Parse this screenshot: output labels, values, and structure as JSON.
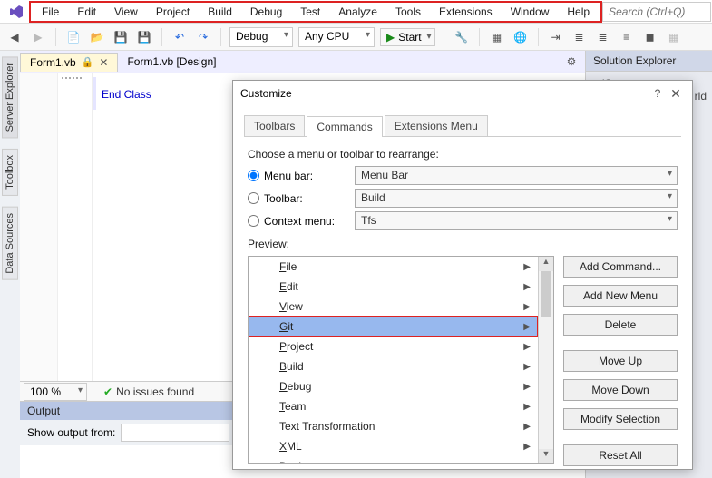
{
  "menubar": [
    "File",
    "Edit",
    "View",
    "Project",
    "Build",
    "Debug",
    "Test",
    "Analyze",
    "Tools",
    "Extensions",
    "Window",
    "Help"
  ],
  "search_placeholder": "Search (Ctrl+Q)",
  "toolbar": {
    "config": "Debug",
    "platform": "Any CPU",
    "start": "Start"
  },
  "tabs": {
    "active": "Form1.vb",
    "inactive": "Form1.vb [Design]"
  },
  "code_line": "End Class",
  "zoom": "100 %",
  "issues": "No issues found",
  "output": {
    "title": "Output",
    "label": "Show output from:"
  },
  "side_tabs": [
    "Server Explorer",
    "Toolbox",
    "Data Sources"
  ],
  "right": {
    "title": "Solution Explorer",
    "row1": "(C",
    "row2": "rld"
  },
  "dialog": {
    "title": "Customize",
    "tabs": [
      "Toolbars",
      "Commands",
      "Extensions Menu"
    ],
    "instruction": "Choose a menu or toolbar to rearrange:",
    "opt_menu": "Menu bar:",
    "opt_toolbar": "Toolbar:",
    "opt_context": "Context menu:",
    "val_menu": "Menu Bar",
    "val_toolbar": "Build",
    "val_context": "Tfs",
    "preview_label": "Preview:",
    "items": [
      "File",
      "Edit",
      "View",
      "Git",
      "Project",
      "Build",
      "Debug",
      "Team",
      "Text Transformation",
      "XML",
      "Design"
    ],
    "buttons": {
      "add_cmd": "Add Command...",
      "add_menu": "Add New Menu",
      "delete": "Delete",
      "move_up": "Move Up",
      "move_down": "Move Down",
      "modify": "Modify Selection",
      "reset": "Reset All"
    }
  }
}
